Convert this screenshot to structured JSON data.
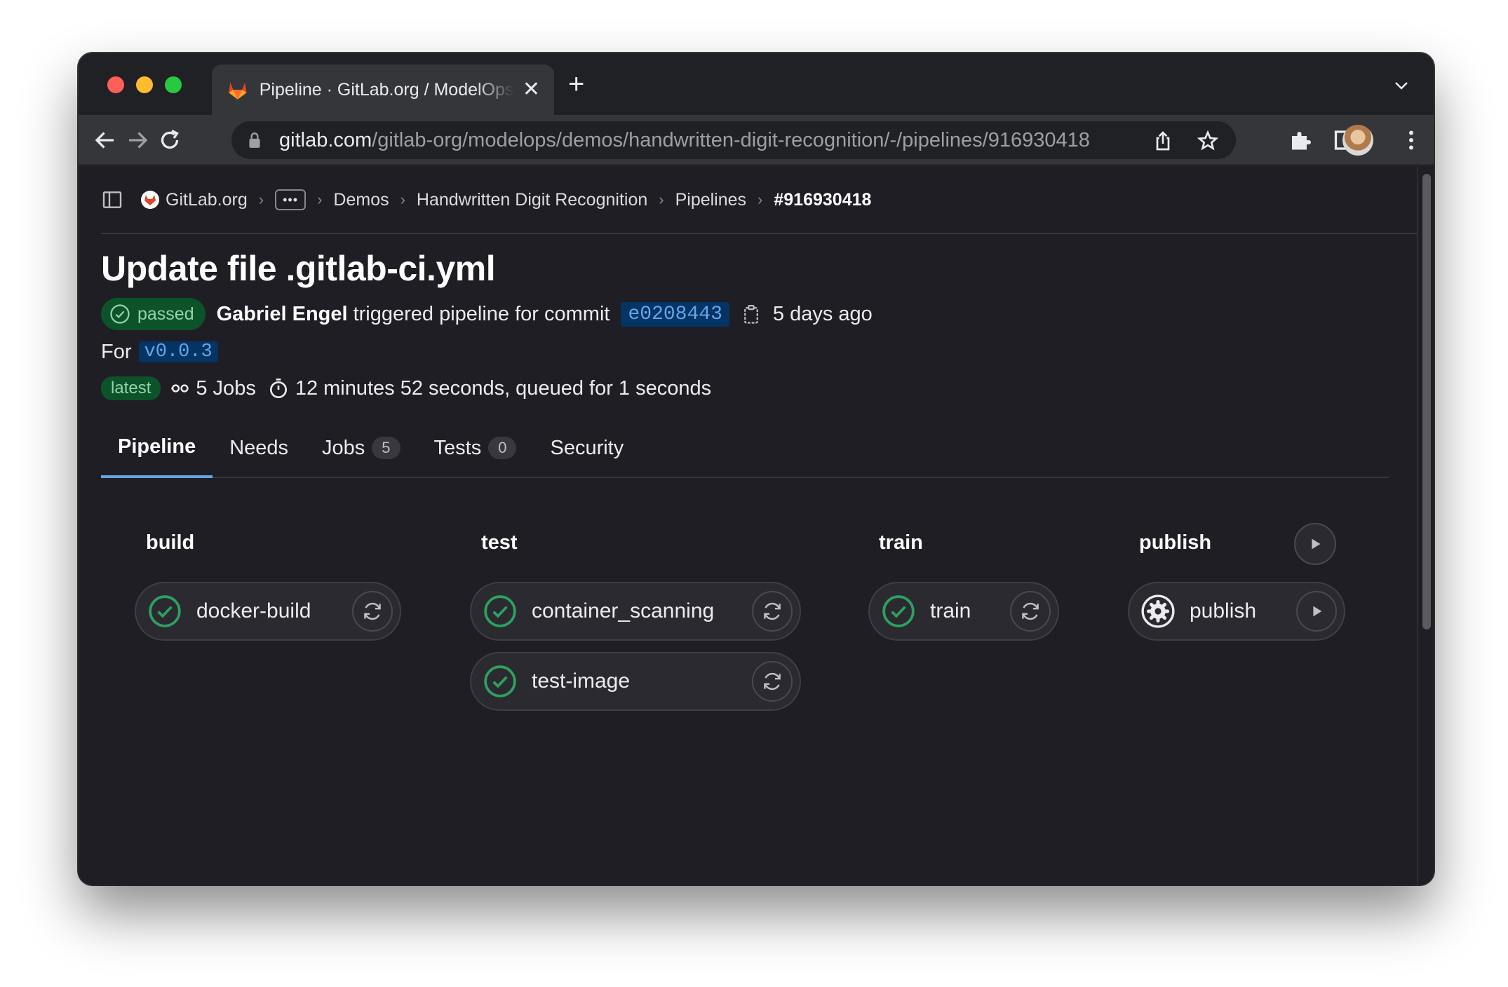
{
  "browser": {
    "tab_title": "Pipeline · GitLab.org / ModelOps",
    "url_host": "gitlab.com",
    "url_path": "/gitlab-org/modelops/demos/handwritten-digit-recognition/-/pipelines/916930418"
  },
  "breadcrumb": {
    "org": "GitLab.org",
    "items": [
      "Demos",
      "Handwritten Digit Recognition",
      "Pipelines"
    ],
    "current": "#916930418"
  },
  "pipeline": {
    "title": "Update file .gitlab-ci.yml",
    "status": "passed",
    "author": "Gabriel Engel",
    "action_text": "triggered pipeline for commit",
    "commit_sha": "e0208443",
    "time_ago": "5 days ago",
    "for_label": "For",
    "ref": "v0.0.3",
    "latest_badge": "latest",
    "jobs_count": "5 Jobs",
    "duration": "12 minutes 52 seconds, queued for 1 seconds"
  },
  "tabs": [
    {
      "label": "Pipeline"
    },
    {
      "label": "Needs"
    },
    {
      "label": "Jobs",
      "count": "5"
    },
    {
      "label": "Tests",
      "count": "0"
    },
    {
      "label": "Security"
    }
  ],
  "stages": [
    {
      "name": "build",
      "jobs": [
        {
          "name": "docker-build",
          "status": "success",
          "action": "retry"
        }
      ]
    },
    {
      "name": "test",
      "jobs": [
        {
          "name": "container_scanning",
          "status": "success",
          "action": "retry"
        },
        {
          "name": "test-image",
          "status": "success",
          "action": "retry"
        }
      ]
    },
    {
      "name": "train",
      "jobs": [
        {
          "name": "train",
          "status": "success",
          "action": "retry"
        }
      ]
    },
    {
      "name": "publish",
      "jobs": [
        {
          "name": "publish",
          "status": "manual",
          "action": "play"
        }
      ]
    }
  ],
  "colors": {
    "success": "#2da160",
    "link": "#63a6e9",
    "background": "#1f1e24"
  }
}
